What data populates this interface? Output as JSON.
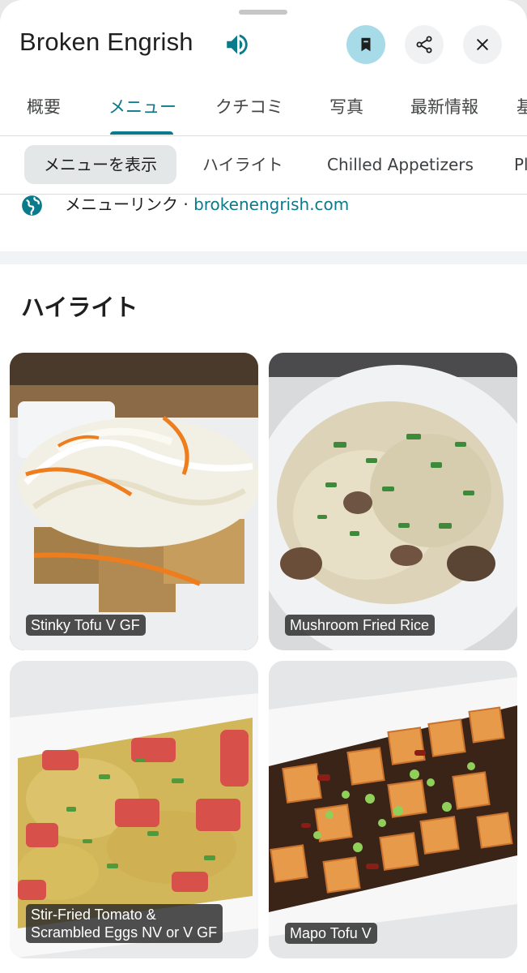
{
  "place": {
    "name": "Broken Engrish",
    "speaker_icon": "volume-icon"
  },
  "header_actions": [
    {
      "name": "save",
      "icon": "bookmark-icon",
      "color": "#a8dbe8"
    },
    {
      "name": "share",
      "icon": "share-icon"
    },
    {
      "name": "close",
      "icon": "close-icon"
    }
  ],
  "tabs": [
    {
      "label": "概要",
      "active": false
    },
    {
      "label": "メニュー",
      "active": true
    },
    {
      "label": "クチコミ",
      "active": false
    },
    {
      "label": "写真",
      "active": false
    },
    {
      "label": "最新情報",
      "active": false
    },
    {
      "label": "基",
      "active": false
    }
  ],
  "chips": [
    {
      "label": "メニューを表示",
      "selected": true
    },
    {
      "label": "ハイライト",
      "selected": false
    },
    {
      "label": "Chilled Appetizers",
      "selected": false
    },
    {
      "label": "Pl",
      "selected": false
    }
  ],
  "menu_link": {
    "label": "メニューリンク · ",
    "url": "brokenengrish.com",
    "icon": "globe-icon"
  },
  "highlights": {
    "title": "ハイライト",
    "items": [
      {
        "name": "Stinky Tofu V GF"
      },
      {
        "name": "Mushroom Fried Rice"
      },
      {
        "line1": "Stir-Fried Tomato &",
        "line2": "Scrambled Eggs NV or V GF"
      },
      {
        "name": "Mapo Tofu V"
      }
    ]
  },
  "colors": {
    "accent": "#0b7a8a",
    "save_button": "#a8dbe8"
  }
}
